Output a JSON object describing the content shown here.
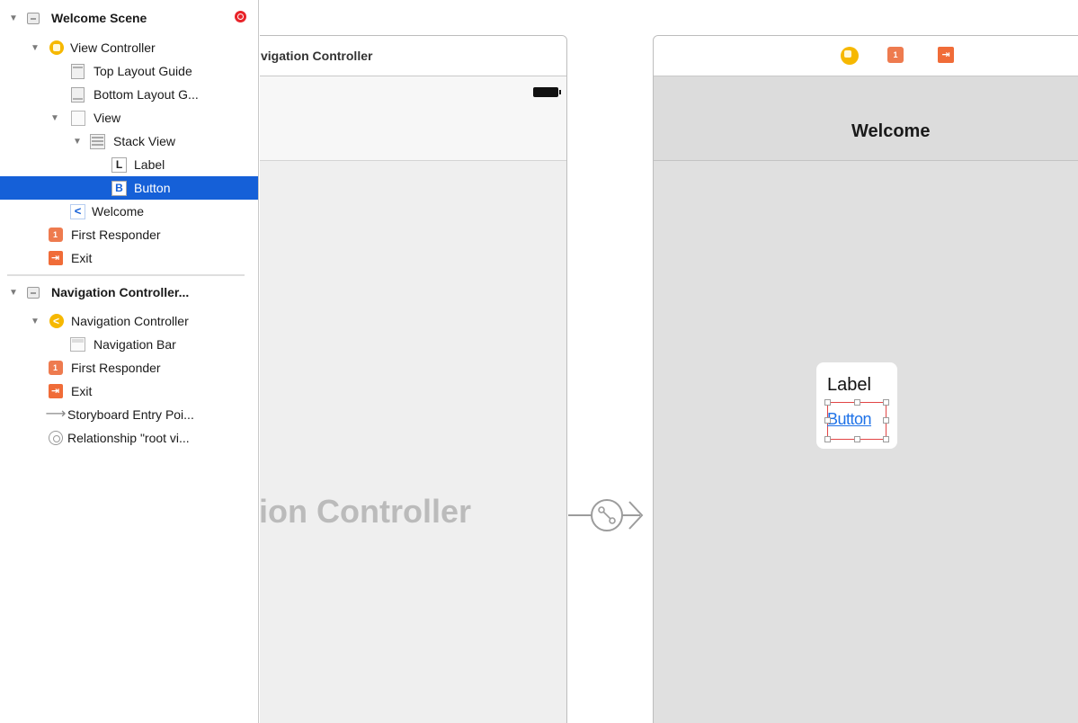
{
  "outline": {
    "items": [
      {
        "label": "Welcome Scene",
        "icon": "scene-icon"
      },
      {
        "label": "View Controller",
        "icon": "view-controller-icon"
      },
      {
        "label": "Top Layout Guide",
        "icon": "layout-guide-icon"
      },
      {
        "label": "Bottom Layout G...",
        "icon": "layout-guide-icon"
      },
      {
        "label": "View",
        "icon": "view-icon"
      },
      {
        "label": "Stack View",
        "icon": "stack-view-icon"
      },
      {
        "label": "Label",
        "icon": "label-icon",
        "glyph": "L"
      },
      {
        "label": "Button",
        "icon": "button-icon",
        "glyph": "B",
        "selected": true
      },
      {
        "label": "Welcome",
        "icon": "navigation-item-icon",
        "glyph": "<"
      },
      {
        "label": "First Responder",
        "icon": "first-responder-icon"
      },
      {
        "label": "Exit",
        "icon": "exit-icon"
      },
      {
        "label": "Navigation Controller...",
        "icon": "scene-icon"
      },
      {
        "label": "Navigation Controller",
        "icon": "navigation-controller-icon",
        "glyph": "<"
      },
      {
        "label": "Navigation Bar",
        "icon": "navigation-bar-icon"
      },
      {
        "label": "First Responder",
        "icon": "first-responder-icon"
      },
      {
        "label": "Exit",
        "icon": "exit-icon"
      },
      {
        "label": "Storyboard Entry Poi...",
        "icon": "entry-point-arrow-icon"
      },
      {
        "label": "Relationship \"root vi...",
        "icon": "relationship-icon"
      }
    ]
  },
  "glyphs": {
    "disclosure": "▼",
    "back": "<",
    "exit": "⇥",
    "responder": "1",
    "arrow": "⟶"
  },
  "canvas": {
    "nav_scene": {
      "title": "vigation Controller",
      "placeholder": "tion Controller"
    },
    "welcome_scene": {
      "nav_title": "Welcome",
      "stack_label": "Label",
      "stack_button": "Button"
    }
  },
  "colors": {
    "selection": "#1560d8",
    "accent_yellow": "#f6b800",
    "accent_orange": "#f06c38",
    "button_text": "#1e72e8",
    "selection_frame": "#e24545",
    "warning": "#e8242a"
  }
}
